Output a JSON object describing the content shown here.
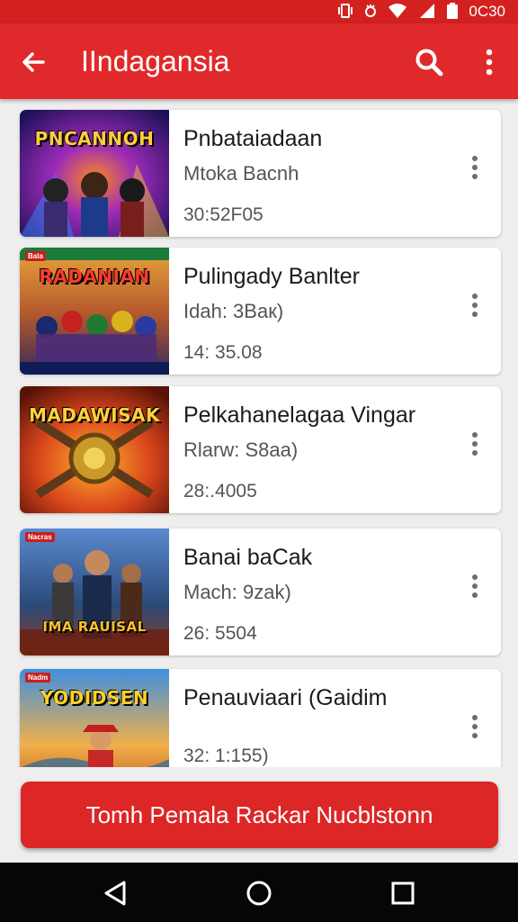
{
  "status_bar": {
    "time": "0C30",
    "icons": [
      "vibrate-icon",
      "alarm-icon",
      "wifi-icon",
      "signal-icon",
      "battery-icon"
    ]
  },
  "app_bar": {
    "title": "IIndagansia",
    "icons": [
      "back-arrow-icon",
      "search-icon",
      "more-vert-icon"
    ]
  },
  "items": [
    {
      "thumb_title": "PNCANNOH",
      "title": "Pnbataiadaan",
      "subtitle": "Mtoka Bacnh",
      "meta": "30:52F05"
    },
    {
      "thumb_title": "RADANIAN",
      "thumb_badge": "Bala",
      "title": "Pulingady Banlter",
      "subtitle": "Idah: 3Baк)",
      "meta": "14: 35.08"
    },
    {
      "thumb_title": "MADAWISAK",
      "title": "Pelkahanelagaa Vingar",
      "subtitle": "Rlarw: S8aa)",
      "meta": "28:.4005"
    },
    {
      "thumb_title": "IMA RAUISAL",
      "thumb_badge": "Nacras",
      "title": "Banai baCak",
      "subtitle": "Mach: 9zak)",
      "meta": "26: 5504"
    },
    {
      "thumb_title": "YODIDSEN",
      "thumb_badge": "Nadm",
      "title": "Penauviaari (Gaidim",
      "subtitle": "",
      "meta": "32: 1:155)"
    }
  ],
  "primary_button": {
    "label": "Tomh Pemala Rackar Nucblstonn"
  },
  "colors": {
    "accent": "#e0292a",
    "status_bar": "#d32120",
    "button": "#dd2626",
    "background": "#eeeeee",
    "nav_bar": "#060606"
  }
}
